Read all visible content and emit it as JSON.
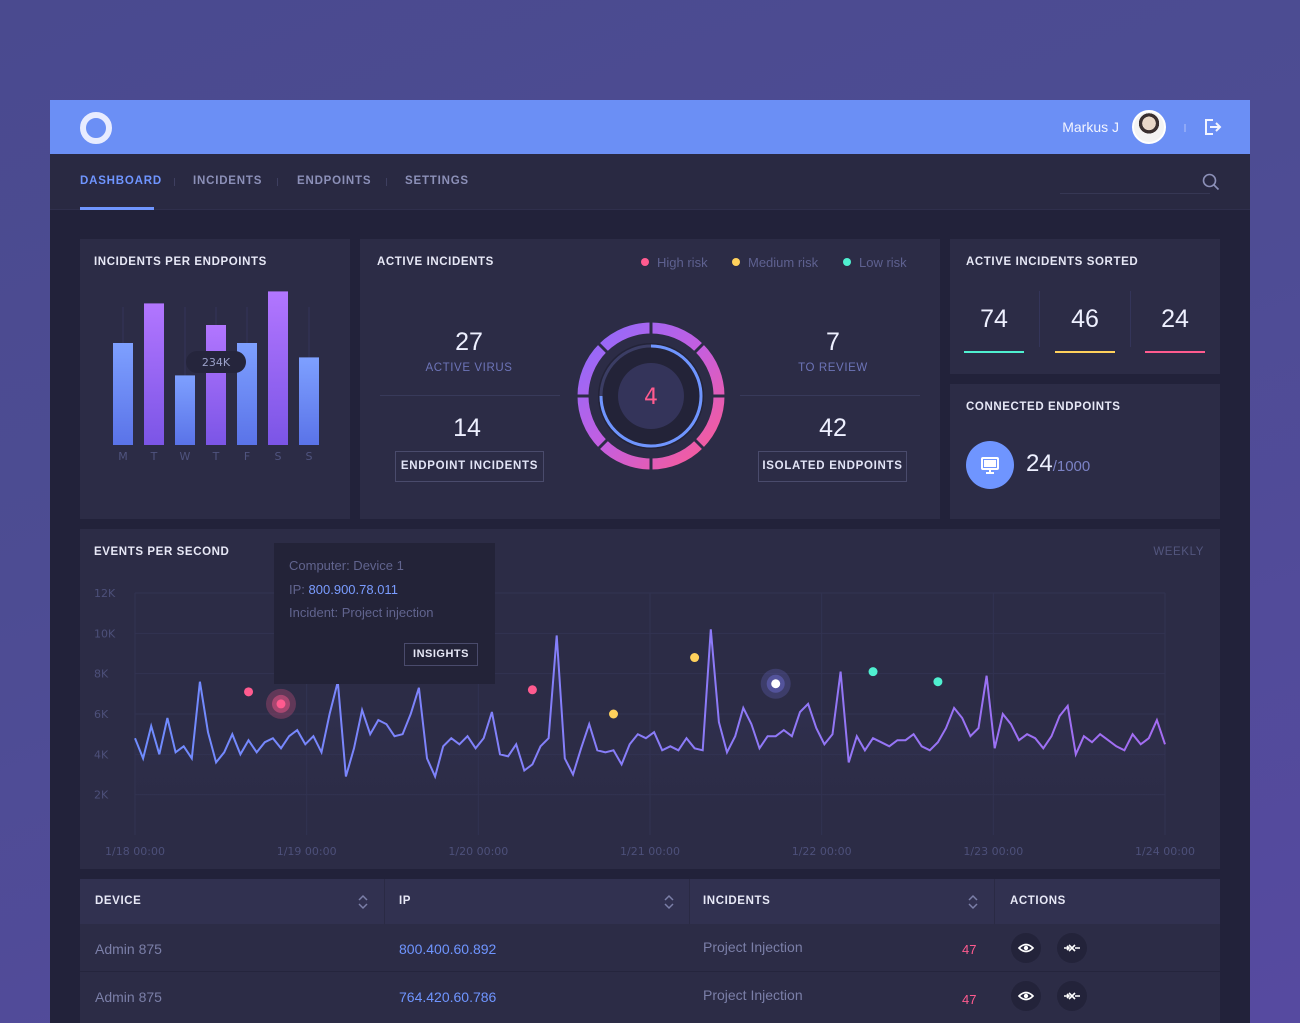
{
  "header": {
    "user_name": "Markus J",
    "icons": [
      "logo-ring",
      "avatar",
      "logout-icon"
    ]
  },
  "nav": {
    "tabs": [
      {
        "label": "DASHBOARD",
        "active": true
      },
      {
        "label": "INCIDENTS",
        "active": false
      },
      {
        "label": "ENDPOINTS",
        "active": false
      },
      {
        "label": "SETTINGS",
        "active": false
      }
    ],
    "search_icon": "search-icon"
  },
  "incidents_per_endpoints": {
    "title": "INCIDENTS PER ENDPOINTS",
    "tooltip": "234K",
    "chart_data": {
      "type": "bar",
      "categories": [
        "M",
        "T",
        "W",
        "T",
        "F",
        "S",
        "S"
      ],
      "values": [
        85,
        118,
        58,
        100,
        85,
        128,
        73
      ],
      "colors": [
        "#6f8cff",
        "#9b6bf2",
        "#6f8cff",
        "#9b6bf2",
        "#6f8cff",
        "#9b6bf2",
        "#6f8cff"
      ],
      "grid": true
    }
  },
  "active_incidents": {
    "title": "ACTIVE INCIDENTS",
    "legend": [
      {
        "label": "High risk",
        "color": "#ff5b8f"
      },
      {
        "label": "Medium risk",
        "color": "#ffd15c"
      },
      {
        "label": "Low risk",
        "color": "#4ff0d0"
      }
    ],
    "center_value": "4",
    "active_virus": {
      "value": "27",
      "label": "ACTIVE VIRUS"
    },
    "to_review": {
      "value": "7",
      "label": "TO REVIEW"
    },
    "endpoint_incidents": {
      "value": "14",
      "label": "ENDPOINT INCIDENTS"
    },
    "isolated_endpoints": {
      "value": "42",
      "label": "ISOLATED ENDPOINTS"
    }
  },
  "active_incidents_sorted": {
    "title": "ACTIVE INCIDENTS SORTED",
    "items": [
      {
        "value": "74",
        "color": "#4ff0d0"
      },
      {
        "value": "46",
        "color": "#ffd15c"
      },
      {
        "value": "24",
        "color": "#ff5b8f"
      }
    ]
  },
  "connected_endpoints": {
    "title": "CONNECTED ENDPOINTS",
    "value": "24",
    "total": "/1000",
    "icon": "monitor-icon"
  },
  "events_per_second": {
    "title": "EVENTS PER SECOND",
    "range": "WEEKLY",
    "tooltip": {
      "computer": "Computer: Device 1",
      "ip_label": "IP:",
      "ip": "800.900.78.011",
      "incident": "Incident: Project injection",
      "button": "INSIGHTS"
    },
    "chart_data": {
      "type": "line",
      "y_ticks": [
        "12K",
        "10K",
        "8K",
        "6K",
        "4K",
        "2K"
      ],
      "x_ticks": [
        "1/18 00:00",
        "1/19 00:00",
        "1/20 00:00",
        "1/21 00:00",
        "1/22 00:00",
        "1/23 00:00",
        "1/24 00:00"
      ],
      "ylim": [
        0,
        12000
      ],
      "grid": true,
      "series": [
        {
          "values": [
            4800,
            3800,
            5400,
            4000,
            5800,
            4100,
            4400,
            3800,
            7600,
            5100,
            3600,
            4100,
            5000,
            4000,
            4700,
            4100,
            4600,
            4800,
            4300,
            4900,
            5200,
            4500,
            4900,
            4100,
            6000,
            7600,
            2900,
            4300,
            6200,
            5000,
            5700,
            5500,
            4900,
            5000,
            6000,
            7300,
            3800,
            2900,
            4400,
            4800,
            4500,
            4900,
            4300,
            4800,
            6100,
            4000,
            3900,
            4500,
            3200,
            3500,
            4400,
            4800,
            9900,
            3800,
            3000,
            4300,
            5500,
            4200,
            4100,
            4200,
            3500,
            4500,
            5000,
            4800,
            5100,
            4200,
            4400,
            4200,
            4800,
            4300,
            4200,
            10200,
            5600,
            4100,
            4900,
            6300,
            5500,
            4300,
            4900,
            4900,
            5200,
            4900,
            6100,
            6500,
            5300,
            4500,
            5000,
            8100,
            3600,
            4900,
            4200,
            4800,
            4600,
            4400,
            4700,
            4700,
            5000,
            4400,
            4200,
            4600,
            5300,
            6300,
            5800,
            4900,
            5300,
            7900,
            4300,
            6000,
            5500,
            4700,
            5000,
            4800,
            4300,
            4900,
            5900,
            6400,
            4000,
            4900,
            4600,
            5000,
            4700,
            4400,
            4200,
            5000,
            4500,
            4800,
            5700,
            4500
          ]
        }
      ],
      "markers": [
        {
          "x_index": 14,
          "value": 7100,
          "color": "#ff5b8f"
        },
        {
          "x_index": 18,
          "value": 6500,
          "color": "#ff5b8f",
          "highlighted": true
        },
        {
          "x_index": 49,
          "value": 7200,
          "color": "#ff5b8f"
        },
        {
          "x_index": 59,
          "value": 6000,
          "color": "#ffd15c"
        },
        {
          "x_index": 69,
          "value": 8800,
          "color": "#ffd15c"
        },
        {
          "x_index": 79,
          "value": 7500,
          "color": "#ffffff",
          "highlighted": true
        },
        {
          "x_index": 91,
          "value": 8100,
          "color": "#4ff0d0"
        },
        {
          "x_index": 99,
          "value": 7600,
          "color": "#4ff0d0"
        }
      ]
    }
  },
  "table": {
    "headers": [
      "DEVICE",
      "IP",
      "INCIDENTS",
      "ACTIONS"
    ],
    "rows": [
      {
        "device": "Admin 875",
        "ip": "800.400.60.892",
        "incident": "Project Injection",
        "count": "47"
      },
      {
        "device": "Admin 875",
        "ip": "764.420.60.786",
        "incident": "Project Injection",
        "count": "47"
      }
    ],
    "action_icons": [
      "eye-icon",
      "isolate-icon"
    ]
  }
}
